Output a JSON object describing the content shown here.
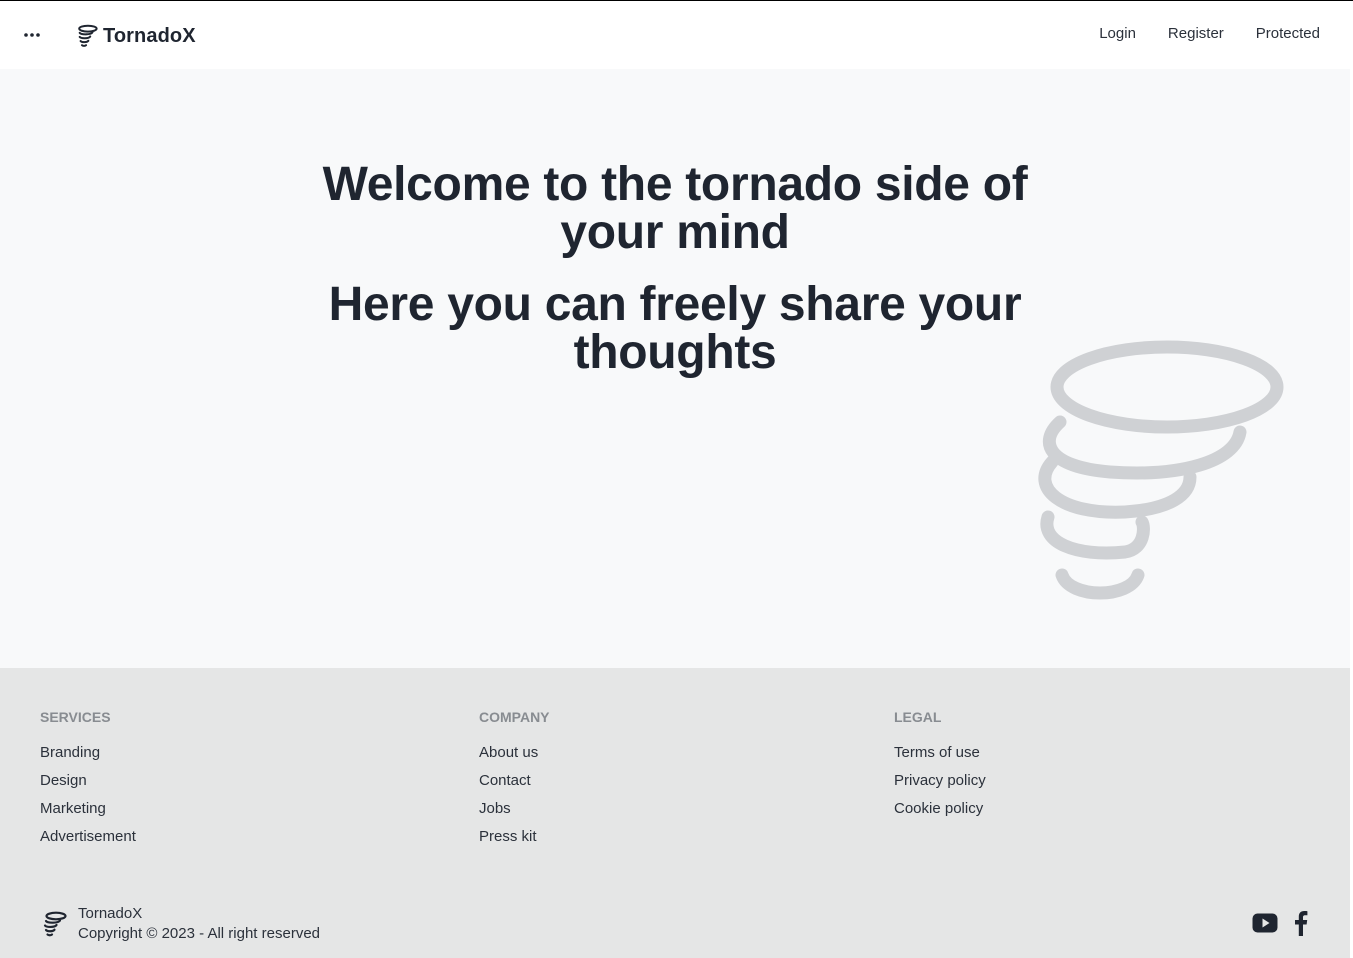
{
  "brand": {
    "name": "TornadoX"
  },
  "nav": {
    "menu_icon": "more-horizontal-icon",
    "links": [
      "Login",
      "Register",
      "Protected"
    ]
  },
  "hero": {
    "title_1": "Welcome to the tornado side of your mind",
    "title_2": "Here you can freely share your thoughts",
    "illustration": "tornado-icon"
  },
  "footer": {
    "services": {
      "heading": "Services",
      "links": [
        "Branding",
        "Design",
        "Marketing",
        "Advertisement"
      ]
    },
    "company": {
      "heading": "Company",
      "links": [
        "About us",
        "Contact",
        "Jobs",
        "Press kit"
      ]
    },
    "legal": {
      "heading": "Legal",
      "links": [
        "Terms of use",
        "Privacy policy",
        "Cookie policy"
      ]
    },
    "brand_name": "TornadoX",
    "copyright": "Copyright © 2023 - All right reserved",
    "socials": [
      "youtube-icon",
      "facebook-icon"
    ]
  },
  "colors": {
    "text": "#1f2530",
    "navbar_bg": "#ffffff",
    "hero_bg": "#f8f9fa",
    "footer_bg": "#e5e6e6",
    "footer_heading": "#888c91",
    "tornado_gray": "#cfd1d4"
  }
}
